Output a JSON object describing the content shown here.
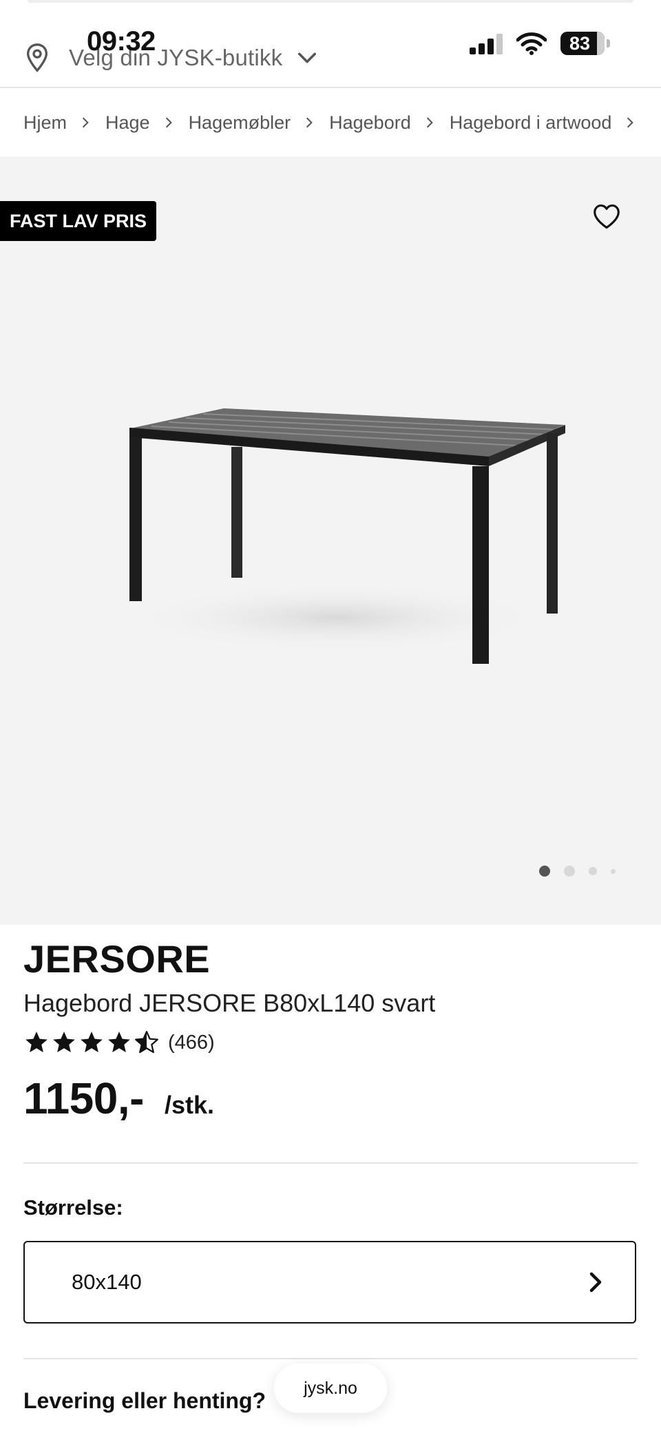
{
  "status_bar": {
    "time": "09:32",
    "battery": "83"
  },
  "header": {
    "store_selector": "Velg din JYSK-butikk"
  },
  "breadcrumb": [
    "Hjem",
    "Hage",
    "Hagemøbler",
    "Hagebord",
    "Hagebord i artwood"
  ],
  "gallery": {
    "badge": "FAST LAV PRIS",
    "active_slide": 1,
    "slide_count": 4
  },
  "product": {
    "brand": "JERSORE",
    "name": "Hagebord JERSORE B80xL140 svart",
    "rating": 4.5,
    "rating_max": 5,
    "review_count": "(466)",
    "price": "1150,-",
    "unit": "/stk."
  },
  "size": {
    "label": "Størrelse:",
    "value": "80x140"
  },
  "delivery": {
    "heading": "Levering eller henting?"
  },
  "browser": {
    "url": "jysk.no"
  }
}
